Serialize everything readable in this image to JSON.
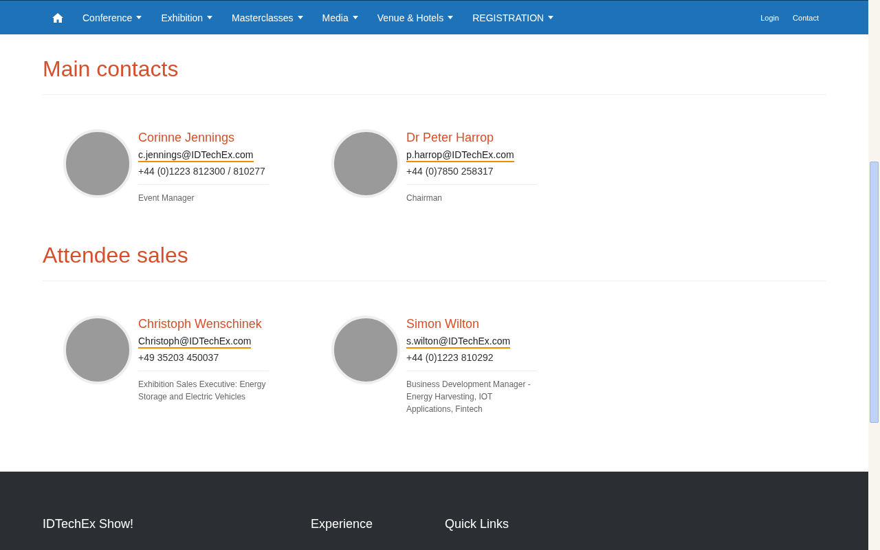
{
  "nav": {
    "items": [
      {
        "label": "Conference"
      },
      {
        "label": "Exhibition"
      },
      {
        "label": "Masterclasses"
      },
      {
        "label": "Media"
      },
      {
        "label": "Venue & Hotels"
      },
      {
        "label": "REGISTRATION"
      }
    ],
    "right_links": [
      "Login",
      "Contact"
    ]
  },
  "sections": [
    {
      "title": "Main contacts",
      "contacts": [
        {
          "name": "Corinne Jennings",
          "email": "c.jennings@IDTechEx.com",
          "phone": "+44 (0)1223 812300 / 810277",
          "role": "Event Manager"
        },
        {
          "name": "Dr Peter Harrop",
          "email": "p.harrop@IDTechEx.com",
          "phone": "+44 (0)7850 258317",
          "role": "Chairman"
        }
      ]
    },
    {
      "title": "Attendee sales",
      "contacts": [
        {
          "name": "Christoph Wenschinek",
          "email": "Christoph@IDTechEx.com",
          "phone": "+49 35203 450037",
          "role": "Exhibition Sales Executive: Energy Storage and Electric Vehicles"
        },
        {
          "name": "Simon Wilton",
          "email": "s.wilton@IDTechEx.com",
          "phone": "+44 (0)1223 810292",
          "role": "Business Development Manager - Energy Harvesting, IOT Applications, Fintech"
        }
      ]
    }
  ],
  "footer": {
    "headings": [
      "IDTechEx Show!",
      "Experience",
      "Quick Links"
    ]
  }
}
